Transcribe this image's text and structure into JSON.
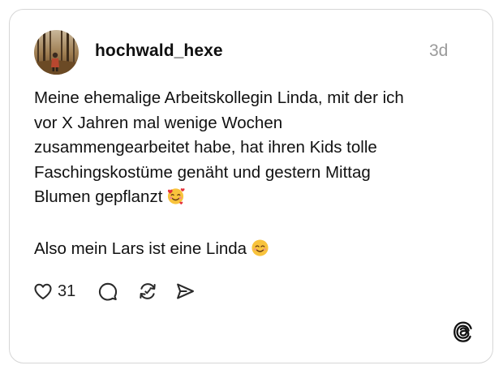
{
  "post": {
    "username": "hochwald_hexe",
    "timestamp": "3d",
    "lines": [
      "Meine ehemalige Arbeitskollegin Linda, mit der ich",
      "vor X Jahren mal wenige Wochen",
      "zusammengearbeitet habe, hat ihren Kids tolle",
      "Faschingskostüme genäht und gestern Mittag",
      "Blumen gepflanzt"
    ],
    "line2": "Also mein Lars ist eine Linda",
    "emoji1": "smiling-face-with-hearts",
    "emoji2": "smiling-face-with-smiling-eyes"
  },
  "actions": {
    "like_count": "31",
    "icons": [
      "heart-icon",
      "comment-icon",
      "repost-icon",
      "share-icon"
    ]
  },
  "branding": {
    "logo": "threads-logo-icon"
  },
  "colors": {
    "text": "#111111",
    "muted": "#9a9a9a",
    "border": "#d6d6d6"
  }
}
